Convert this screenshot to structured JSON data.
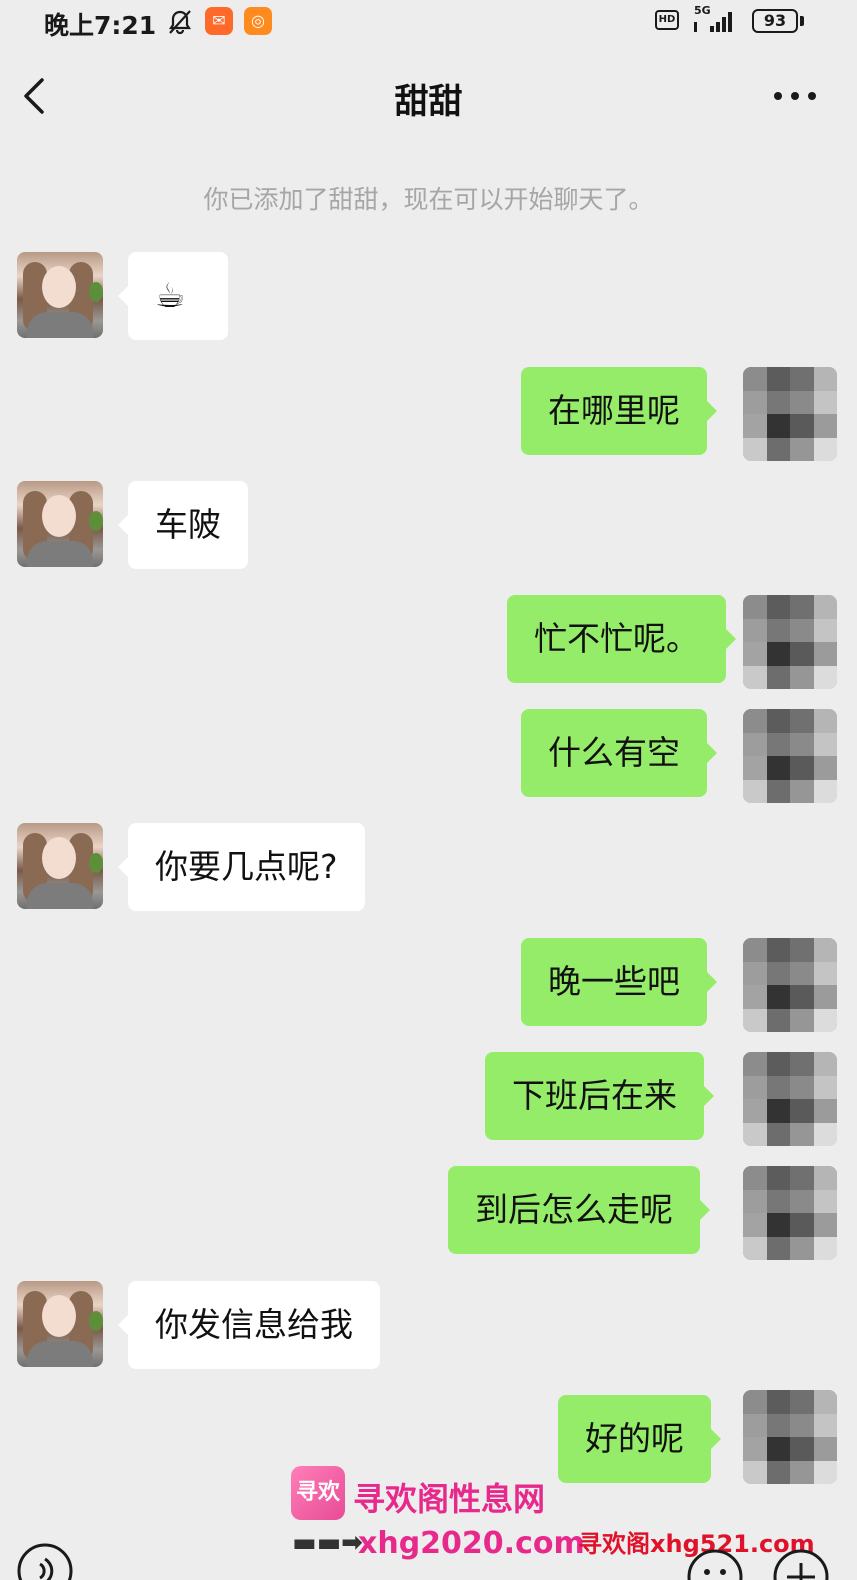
{
  "status_bar": {
    "time": "晚上7:21",
    "hd": "HD",
    "network": "5G",
    "battery": "93"
  },
  "header": {
    "title": "甜甜"
  },
  "system_notice": "你已添加了甜甜，现在可以开始聊天了。",
  "messages": [
    {
      "from": "contact",
      "text": "☕"
    },
    {
      "from": "me",
      "text": "在哪里呢"
    },
    {
      "from": "contact",
      "text": "车陂"
    },
    {
      "from": "me",
      "text": "忙不忙呢。"
    },
    {
      "from": "me",
      "text": "什么有空"
    },
    {
      "from": "contact",
      "text": "你要几点呢?"
    },
    {
      "from": "me",
      "text": "晚一些吧"
    },
    {
      "from": "me",
      "text": "下班后在来"
    },
    {
      "from": "me",
      "text": "到后怎么走呢"
    },
    {
      "from": "contact",
      "text": "你发信息给我"
    },
    {
      "from": "me",
      "text": "好的呢"
    }
  ],
  "watermark": {
    "logo_text": "寻欢",
    "title": "寻欢阁性息网",
    "arrow": "▬▬➡",
    "url": "xhg2020.com",
    "url2": "寻欢阁xhg521.com"
  },
  "colors": {
    "background": "#ededed",
    "bubble_out": "#95ec69",
    "bubble_in": "#ffffff",
    "watermark": "#e8298c"
  }
}
